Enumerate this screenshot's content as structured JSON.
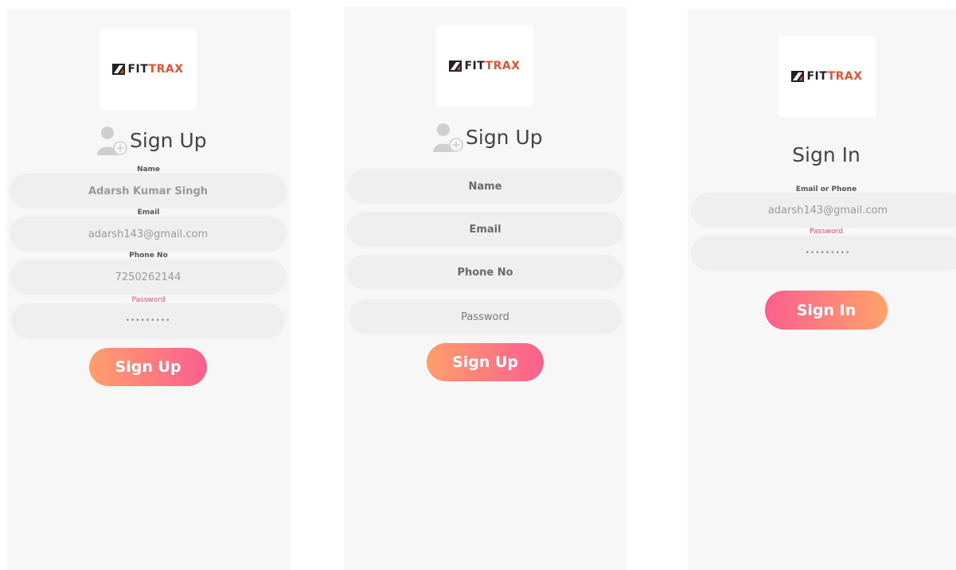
{
  "colors": {
    "screen_bg": "#f7f7f7",
    "field_bg": "#efefef",
    "password_label": "#e84a7a",
    "cta_gradient_start": "#ff9a6a",
    "cta_gradient_end": "#fb5f8e",
    "logo_dark": "#222222",
    "logo_orange": "#e8502e"
  },
  "logo": {
    "text_dark": "FIT",
    "text_orange": "TRAX"
  },
  "screens": [
    {
      "title": "Sign Up",
      "fields": [
        {
          "label": "Name",
          "value": "Adarsh Kumar Singh"
        },
        {
          "label": "Email",
          "value": "adarsh143@gmail.com"
        },
        {
          "label": "Phone No",
          "value": "7250262144"
        },
        {
          "label": "Password",
          "value": "•••••••••"
        }
      ],
      "button": "Sign Up"
    },
    {
      "title": "Sign Up",
      "fields": [
        {
          "placeholder": "Name"
        },
        {
          "placeholder": "Email"
        },
        {
          "placeholder": "Phone No"
        },
        {
          "placeholder": "Password"
        }
      ],
      "button": "Sign Up"
    },
    {
      "title": "Sign In",
      "fields": [
        {
          "label": "Email or Phone",
          "value": "adarsh143@gmail.com"
        },
        {
          "label": "Password",
          "value": "•••••••••"
        }
      ],
      "button": "Sign In"
    }
  ]
}
